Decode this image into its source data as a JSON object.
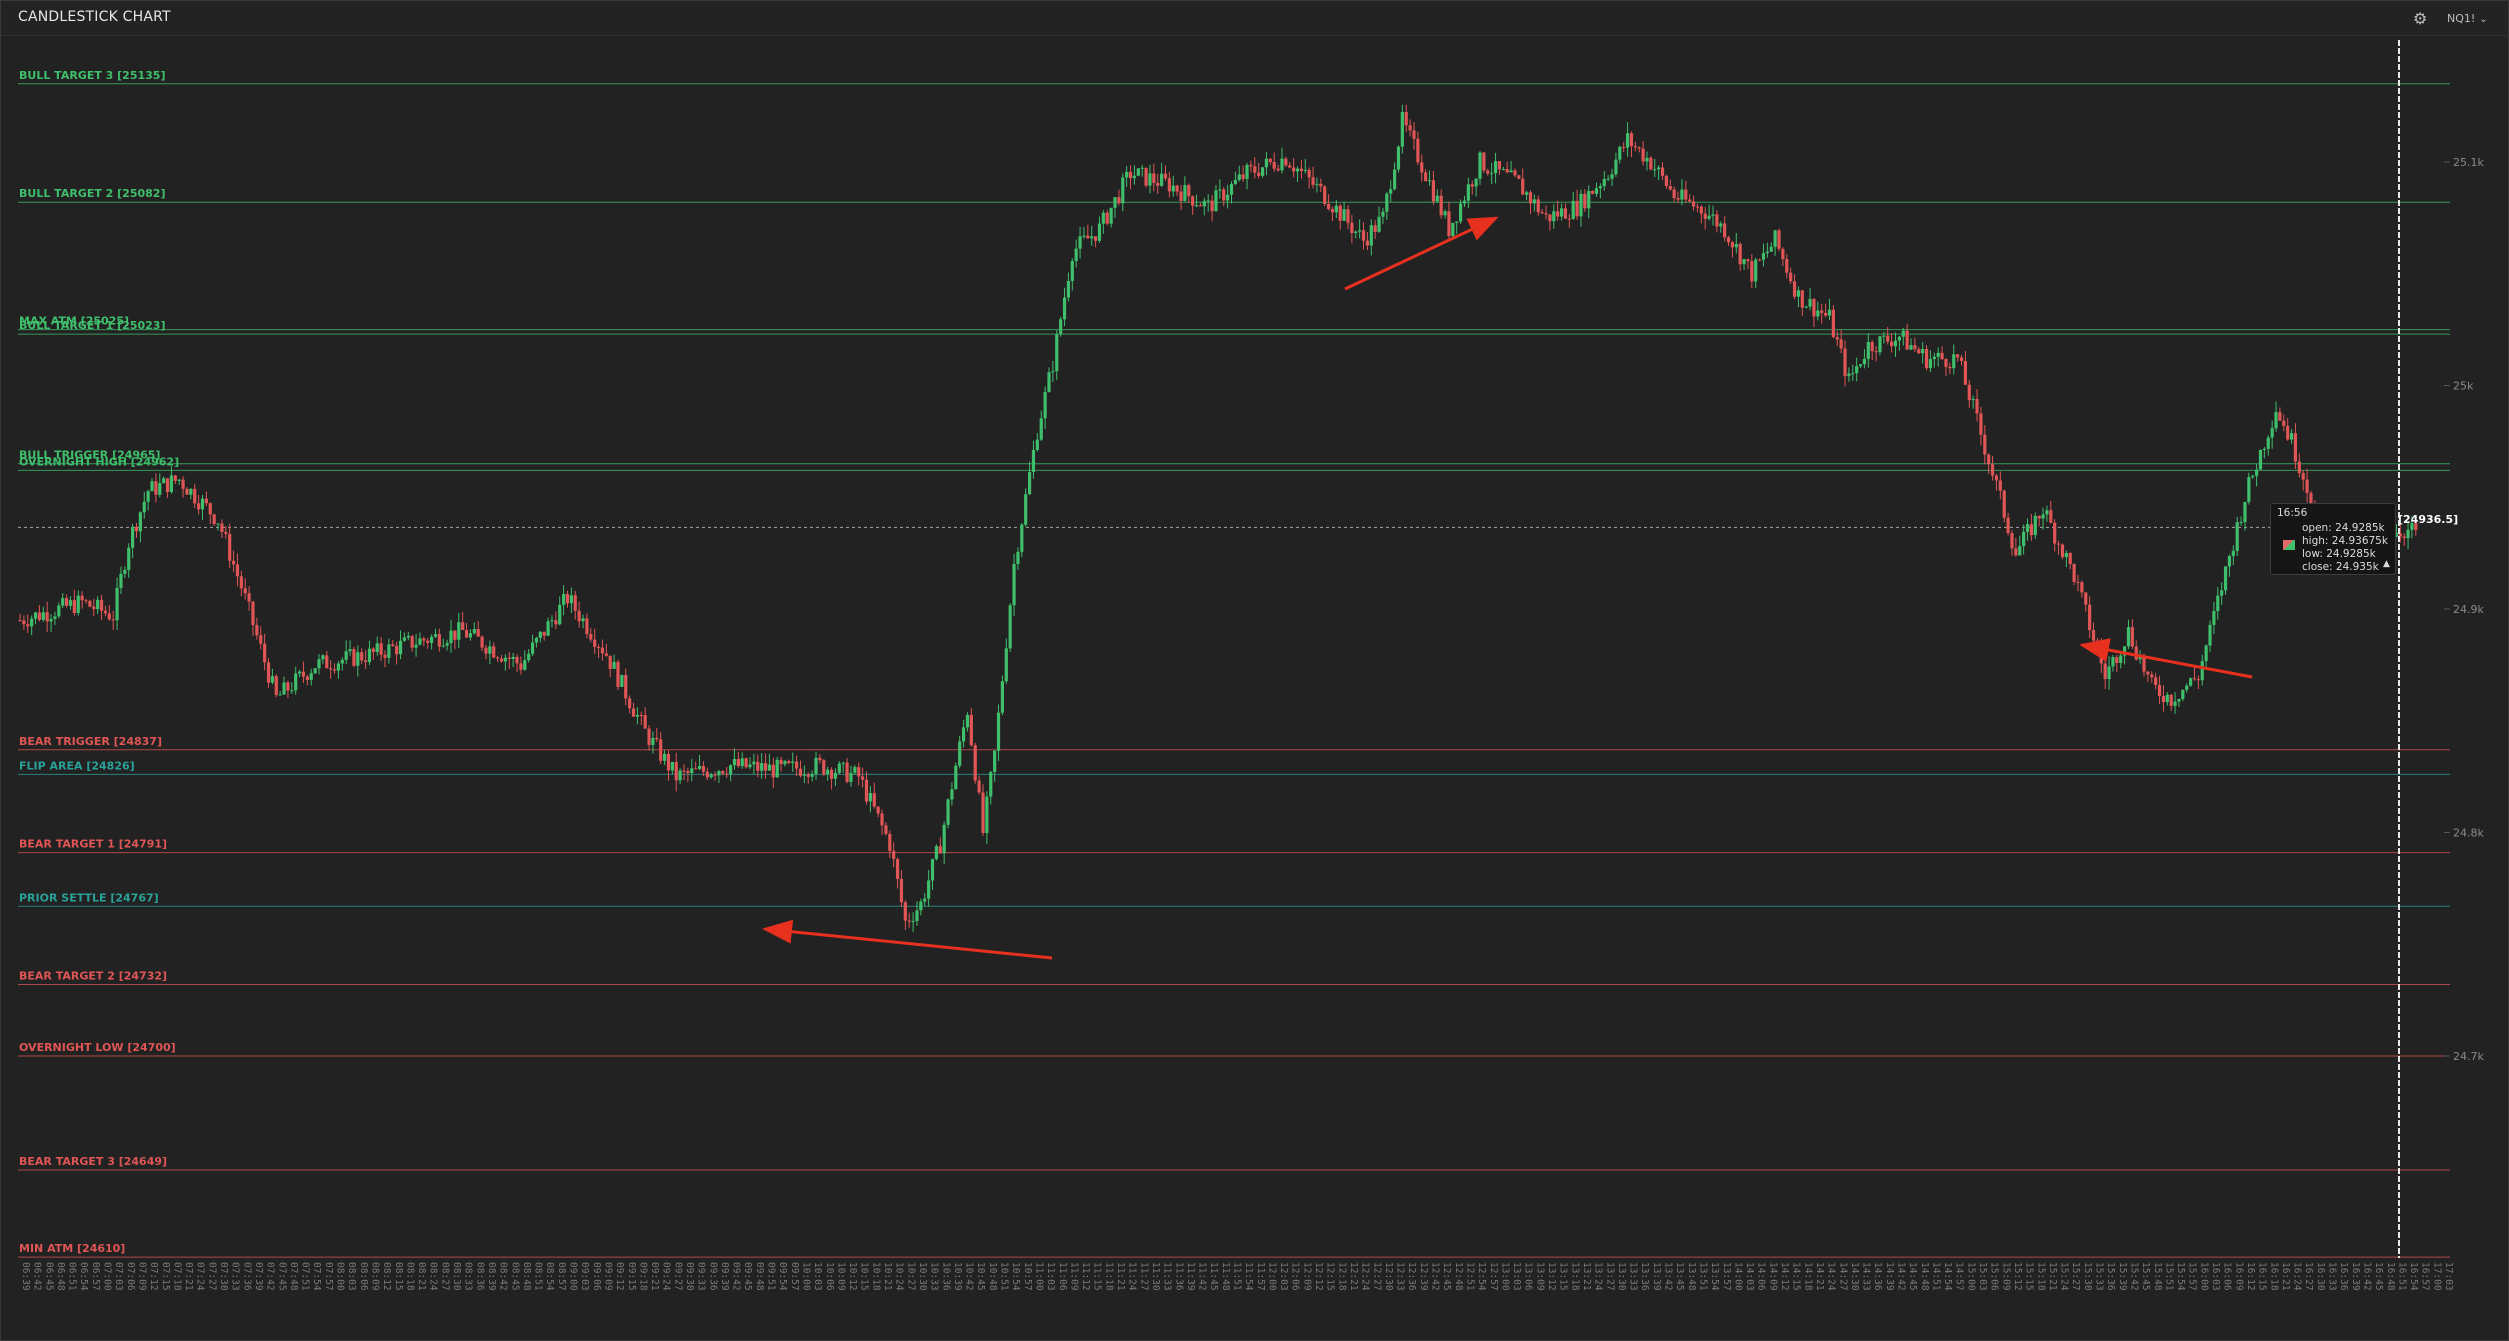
{
  "header": {
    "title": "CANDLESTICK CHART",
    "symbol": "NQ1!",
    "settings_icon": "gear-icon"
  },
  "colors": {
    "bull": "#3fbf6b",
    "bear": "#e05555",
    "teal": "#2aa198",
    "background": "#222222"
  },
  "chart_data": {
    "type": "candlestick",
    "y_axis": {
      "ticks": [
        "25.1k",
        "25k",
        "24.9k",
        "24.8k",
        "24.7k"
      ],
      "tick_values": [
        25100,
        25000,
        24900,
        24800,
        24700
      ],
      "range": [
        24606,
        25170
      ]
    },
    "levels": [
      {
        "label": "BULL TARGET 3 [25135]",
        "value": 25135,
        "kind": "bull"
      },
      {
        "label": "BULL TARGET 2 [25082]",
        "value": 25082,
        "kind": "bull"
      },
      {
        "label": "MAX ATM [25025]",
        "value": 25025,
        "kind": "bull"
      },
      {
        "label": "BULL TARGET 1 [25023]",
        "value": 25023,
        "kind": "bull"
      },
      {
        "label": "BULL TRIGGER [24965]",
        "value": 24965,
        "kind": "bull"
      },
      {
        "label": "OVERNIGHT HIGH [24962]",
        "value": 24962,
        "kind": "bull"
      },
      {
        "label": "BEAR TRIGGER [24837]",
        "value": 24837,
        "kind": "bear"
      },
      {
        "label": "FLIP AREA [24826]",
        "value": 24826,
        "kind": "teal"
      },
      {
        "label": "BEAR TARGET 1 [24791]",
        "value": 24791,
        "kind": "bear"
      },
      {
        "label": "PRIOR SETTLE [24767]",
        "value": 24767,
        "kind": "teal"
      },
      {
        "label": "BEAR TARGET 2 [24732]",
        "value": 24732,
        "kind": "bear"
      },
      {
        "label": "OVERNIGHT LOW [24700]",
        "value": 24700,
        "kind": "bear"
      },
      {
        "label": "BEAR TARGET 3 [24649]",
        "value": 24649,
        "kind": "bear"
      },
      {
        "label": "MIN ATM [24610]",
        "value": 24610,
        "kind": "bear"
      }
    ],
    "last_price": {
      "label": "24936.5",
      "value": 24936.5
    },
    "tooltip": {
      "time": "16:56",
      "open": "open: 24.9285k",
      "high": "high: 24.93675k",
      "low": "low: 24.9285k",
      "close": "close: 24.935k"
    },
    "x_axis": {
      "start": "06:39",
      "end": "17:03",
      "step_minutes": 3
    },
    "price_path": [
      [
        "06:39",
        24895
      ],
      [
        "06:55",
        24903
      ],
      [
        "07:03",
        24897
      ],
      [
        "07:07",
        24930
      ],
      [
        "07:12",
        24953
      ],
      [
        "07:20",
        24958
      ],
      [
        "07:30",
        24940
      ],
      [
        "07:36",
        24910
      ],
      [
        "07:45",
        24860
      ],
      [
        "07:55",
        24875
      ],
      [
        "08:10",
        24880
      ],
      [
        "08:20",
        24885
      ],
      [
        "08:33",
        24890
      ],
      [
        "08:48",
        24875
      ],
      [
        "09:00",
        24905
      ],
      [
        "09:10",
        24880
      ],
      [
        "09:20",
        24845
      ],
      [
        "09:28",
        24825
      ],
      [
        "09:42",
        24830
      ],
      [
        "09:55",
        24828
      ],
      [
        "10:05",
        24830
      ],
      [
        "10:15",
        24825
      ],
      [
        "10:23",
        24795
      ],
      [
        "10:27",
        24760
      ],
      [
        "10:31",
        24768
      ],
      [
        "10:36",
        24795
      ],
      [
        "10:40",
        24830
      ],
      [
        "10:43",
        24855
      ],
      [
        "10:47",
        24800
      ],
      [
        "10:50",
        24835
      ],
      [
        "10:55",
        24920
      ],
      [
        "11:01",
        24980
      ],
      [
        "11:05",
        25010
      ],
      [
        "11:10",
        25060
      ],
      [
        "11:17",
        25070
      ],
      [
        "11:25",
        25095
      ],
      [
        "11:35",
        25090
      ],
      [
        "11:45",
        25080
      ],
      [
        "11:55",
        25095
      ],
      [
        "12:05",
        25102
      ],
      [
        "12:15",
        25085
      ],
      [
        "12:25",
        25065
      ],
      [
        "12:30",
        25075
      ],
      [
        "12:35",
        25118
      ],
      [
        "12:41",
        25095
      ],
      [
        "12:47",
        25070
      ],
      [
        "12:55",
        25100
      ],
      [
        "13:05",
        25090
      ],
      [
        "13:12",
        25075
      ],
      [
        "13:20",
        25080
      ],
      [
        "13:28",
        25095
      ],
      [
        "13:33",
        25110
      ],
      [
        "13:39",
        25100
      ],
      [
        "13:45",
        25085
      ],
      [
        "13:53",
        25078
      ],
      [
        "13:58",
        25070
      ],
      [
        "14:05",
        25050
      ],
      [
        "14:11",
        25065
      ],
      [
        "14:17",
        25040
      ],
      [
        "14:25",
        25030
      ],
      [
        "14:30",
        25002
      ],
      [
        "14:35",
        25018
      ],
      [
        "14:43",
        25022
      ],
      [
        "14:50",
        25012
      ],
      [
        "14:58",
        25012
      ],
      [
        "15:02",
        24990
      ],
      [
        "15:08",
        24955
      ],
      [
        "15:13",
        24925
      ],
      [
        "15:20",
        24945
      ],
      [
        "15:28",
        24915
      ],
      [
        "15:36",
        24870
      ],
      [
        "15:42",
        24890
      ],
      [
        "15:48",
        24865
      ],
      [
        "15:53",
        24860
      ],
      [
        "16:00",
        24870
      ],
      [
        "16:06",
        24910
      ],
      [
        "16:12",
        24950
      ],
      [
        "16:20",
        24990
      ],
      [
        "16:24",
        24975
      ],
      [
        "16:28",
        24955
      ],
      [
        "16:32",
        24935
      ],
      [
        "16:40",
        24938
      ],
      [
        "16:48",
        24935
      ],
      [
        "16:56",
        24935
      ]
    ]
  }
}
